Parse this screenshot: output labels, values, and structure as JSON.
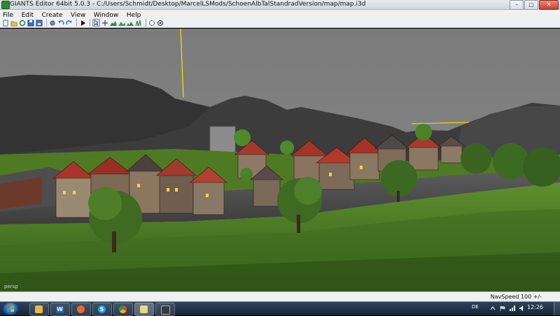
{
  "window": {
    "title": "GIANTS Editor 64bit 5.0.3 - C:/Users/Schmidt/Desktop/MarcelLSMods/SchoenAlbTalStandradVersion/map/map.i3d",
    "controls": [
      "–",
      "▢",
      "✕"
    ]
  },
  "menu": [
    "File",
    "Edit",
    "Create",
    "View",
    "Window",
    "Help"
  ],
  "toolbar": {
    "icons": [
      "new-file-icon",
      "open-icon",
      "reload-icon",
      "save-icon",
      "save-as-icon",
      "settings-icon",
      "undo-icon",
      "redo-icon",
      "play-icon",
      "select-icon",
      "move-icon",
      "terrain-sculpt-icon",
      "terrain-paint-icon",
      "foliage-paint-icon",
      "grass-icon",
      "shader-icon",
      "render-icon"
    ]
  },
  "viewport": {
    "camera_label": "persp"
  },
  "status": {
    "nav_speed": "NavSpeed 100 +/-"
  },
  "taskbar": {
    "apps": [
      "explorer",
      "word",
      "firefox",
      "skype",
      "chrome",
      "giants-editor",
      "unknown"
    ],
    "language": "DE",
    "time": "12:26"
  }
}
